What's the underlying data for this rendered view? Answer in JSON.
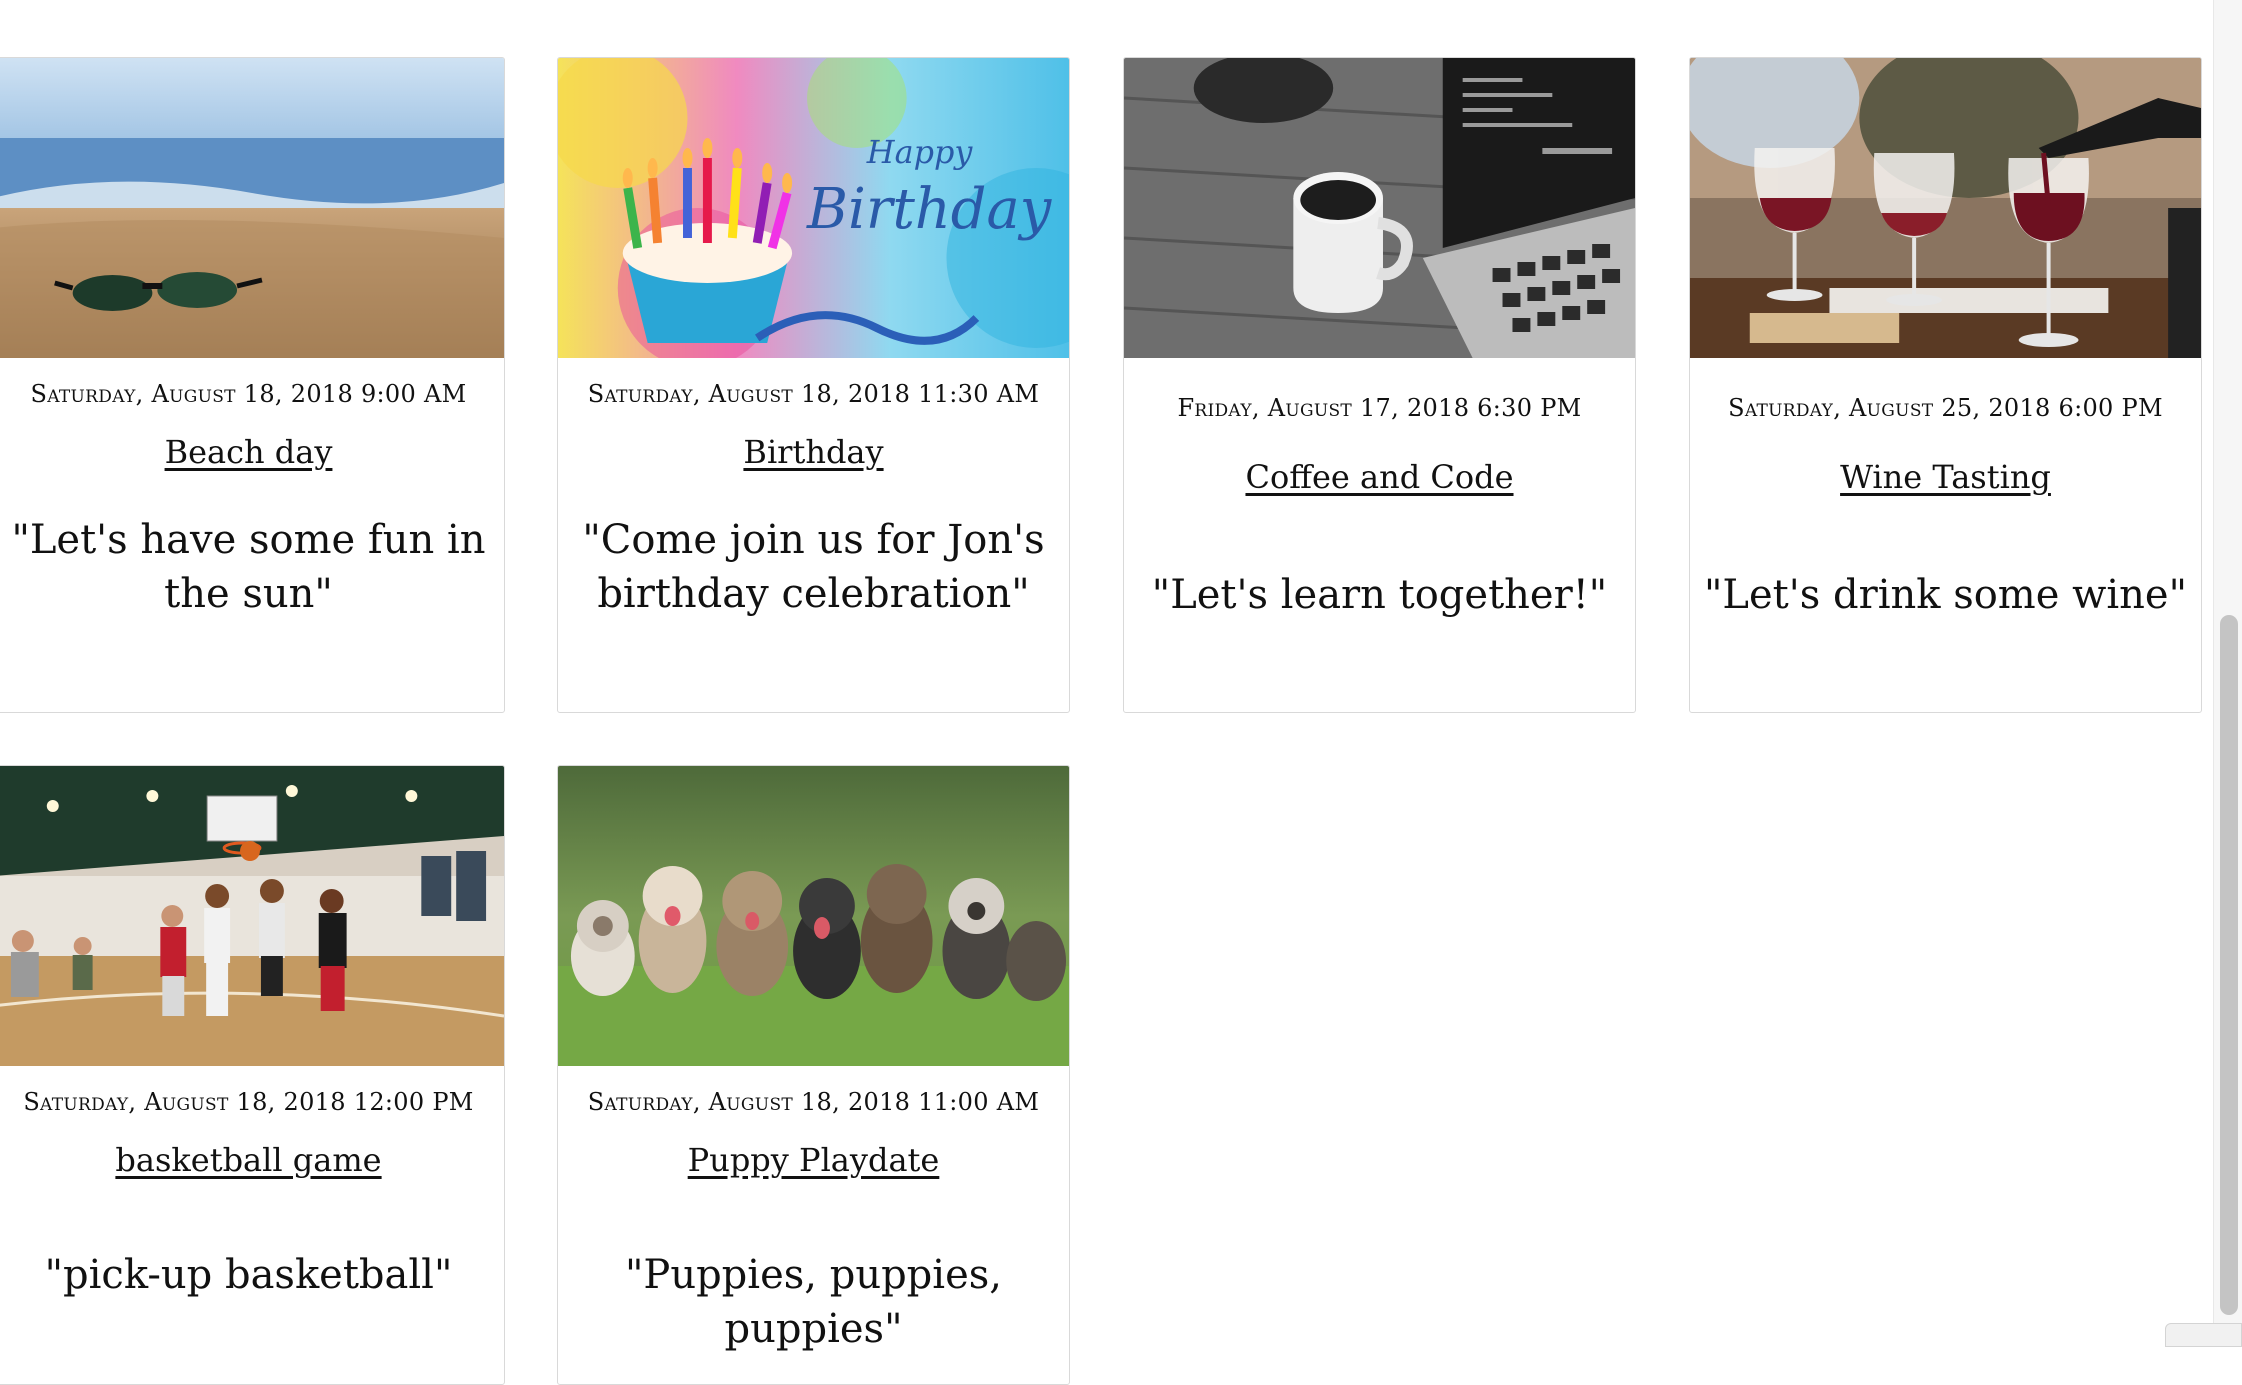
{
  "events": [
    {
      "date": "Saturday, August 18, 2018 9:00 AM",
      "title": "Beach day",
      "description": "\"Let's have some fun in the sun\"",
      "image_icon": "beach-sunglasses-image"
    },
    {
      "date": "Saturday, August 18, 2018 11:30 AM",
      "title": "Birthday",
      "description": "\"Come join us for Jon's birthday celebration\"",
      "image_icon": "birthday-cupcake-image",
      "image_text": [
        "Happy",
        "Birthday"
      ]
    },
    {
      "date": "Friday, August 17, 2018 6:30 PM",
      "title": "Coffee and Code",
      "description": "\"Let's learn together!\"",
      "image_icon": "coffee-laptop-image"
    },
    {
      "date": "Saturday, August 25, 2018 6:00 PM",
      "title": "Wine Tasting",
      "description": "\"Let's drink some wine\"",
      "image_icon": "wine-glasses-image"
    },
    {
      "date": "Saturday, August 18, 2018 12:00 PM",
      "title": "basketball game",
      "description": "\"pick-up basketball\"",
      "image_icon": "basketball-gym-image"
    },
    {
      "date": "Saturday, August 18, 2018 11:00 AM",
      "title": "Puppy Playdate",
      "description": "\"Puppies, puppies, puppies\"",
      "image_icon": "puppies-image"
    }
  ]
}
